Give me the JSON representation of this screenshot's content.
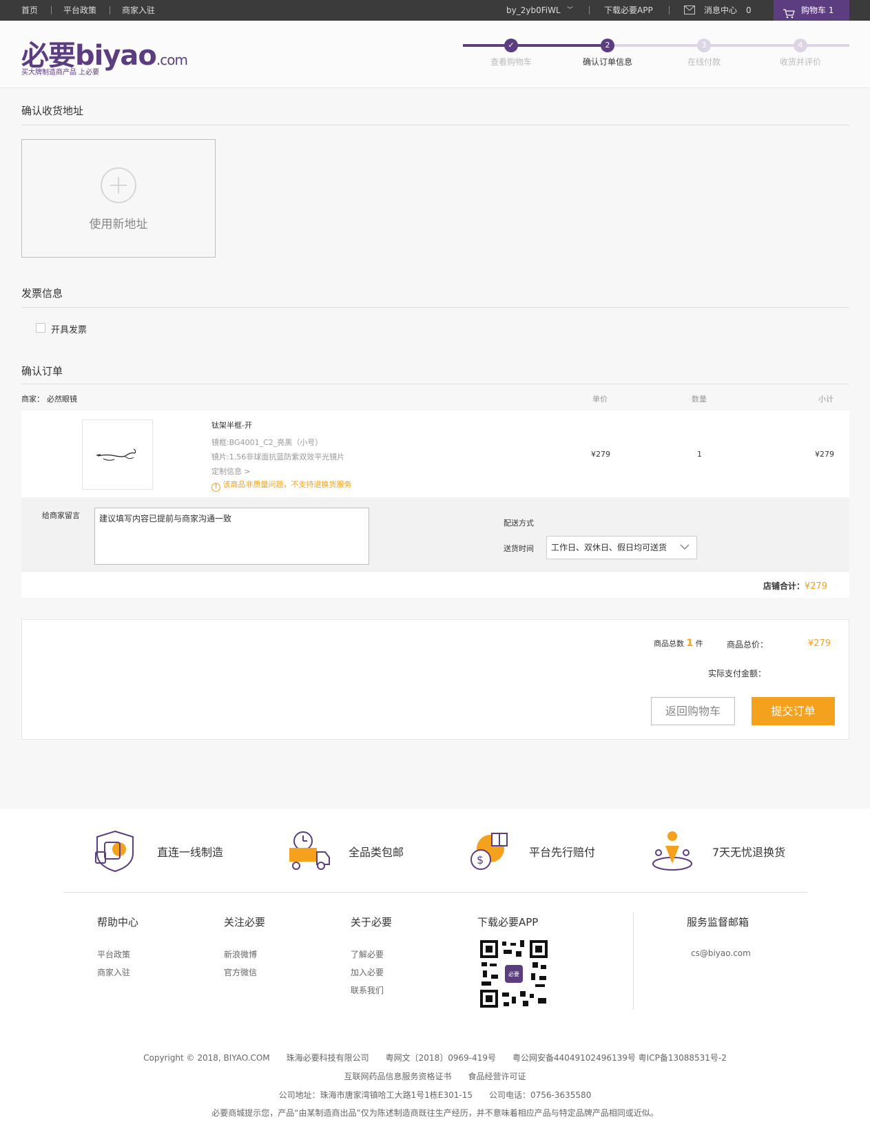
{
  "topbar": {
    "home": "首页",
    "policy": "平台政策",
    "merchant": "商家入驻",
    "username": "by_2yb0FiWL",
    "download_app": "下载必要APP",
    "messages": "消息中心",
    "message_count": "0",
    "cart": "购物车 1"
  },
  "header": {
    "logo_text": "必要biyao",
    "logo_suffix": ".com",
    "slogan": "买大牌制造商产品 上必要",
    "steps": [
      {
        "num": "✓",
        "label": "查看购物车",
        "state": "done"
      },
      {
        "num": "2",
        "label": "确认订单信息",
        "state": "current"
      },
      {
        "num": "3",
        "label": "在线付款",
        "state": "todo"
      },
      {
        "num": "4",
        "label": "收货并评价",
        "state": "todo"
      }
    ]
  },
  "address": {
    "title": "确认收货地址",
    "new_label": "使用新地址"
  },
  "invoice": {
    "title": "发票信息",
    "checkbox_label": "开具发票"
  },
  "order": {
    "title": "确认订单",
    "merchant_prefix": "商家：",
    "merchant_name": "必然眼镜",
    "col_price": "单价",
    "col_qty": "数量",
    "col_subtotal": "小计",
    "product": {
      "name": "钛架半框-开",
      "spec1": "镜框:BG4001_C2_亮黑（小号）",
      "spec2": "镜片:1.56非球面抗蓝防紫双效平光镜片",
      "custom": "定制信息 >",
      "warning": "该商品非质量问题，不支持退换货服务",
      "price": "¥279",
      "qty": "1",
      "subtotal": "¥279"
    },
    "message_label": "给商家留言",
    "message_placeholder": "建议填写内容已提前与商家沟通一致",
    "delivery_title": "配送方式",
    "delivery_time_label": "送货时间",
    "delivery_time_value": "工作日、双休日、假日均可送货",
    "store_total_label": "店铺合计：",
    "store_total_value": "¥279"
  },
  "summary": {
    "count_prefix": "商品总数",
    "count": "1",
    "count_suffix": "件",
    "total_label": "商品总价：",
    "total_value": "¥279",
    "pay_label": "实际支付金额：",
    "back_button": "返回购物车",
    "submit_button": "提交订单"
  },
  "footer": {
    "features": [
      "直连一线制造",
      "全品类包邮",
      "平台先行赔付",
      "7天无忧退换货"
    ],
    "help": {
      "title": "帮助中心",
      "links": [
        "平台政策",
        "商家入驻"
      ]
    },
    "follow": {
      "title": "关注必要",
      "links": [
        "新浪微博",
        "官方微信"
      ]
    },
    "about": {
      "title": "关于必要",
      "links": [
        "了解必要",
        "加入必要",
        "联系我们"
      ]
    },
    "app": {
      "title": "下载必要APP",
      "qr_badge": "必要"
    },
    "mail": {
      "title": "服务监督邮箱",
      "email": "cs@biyao.com"
    },
    "legal1": "Copyright © 2018, BIYAO.COM　　珠海必要科技有限公司　　粤网文〔2018〕0969-419号　　粤公网安备44049102496139号 粤ICP备13088531号-2",
    "legal2": "互联网药品信息服务资格证书　　食品经营许可证",
    "legal3": "公司地址：珠海市唐家湾镇哈工大路1号1栋E301-15　　公司电话：0756-3635580",
    "legal4": "必要商城提示您，产品“由某制造商出品”仅为陈述制造商既往生产经历，并不意味着相应产品与特定品牌产品相同或近似。"
  },
  "colors": {
    "brand_purple": "#5b3d80",
    "accent_orange": "#f4a11d",
    "topbar_bg": "#3b3b3b"
  }
}
